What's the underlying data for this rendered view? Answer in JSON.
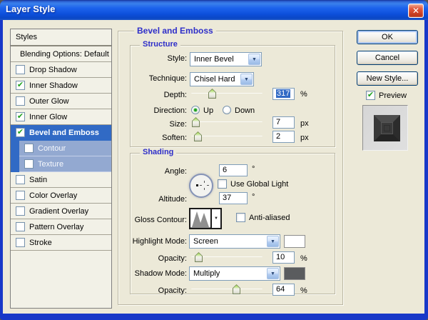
{
  "window": {
    "title": "Layer Style"
  },
  "icons": {
    "close": "✕",
    "combo_arrow": "▼",
    "check": "✔",
    "contour_arrow": "▼"
  },
  "sidebar": {
    "header": "Styles",
    "items": [
      {
        "label": "Blending Options: Default",
        "type": "plain"
      },
      {
        "label": "Drop Shadow",
        "checked": false
      },
      {
        "label": "Inner Shadow",
        "checked": true
      },
      {
        "label": "Outer Glow",
        "checked": false
      },
      {
        "label": "Inner Glow",
        "checked": true
      },
      {
        "label": "Bevel and Emboss",
        "checked": true,
        "selected": true
      },
      {
        "label": "Contour",
        "checked": false,
        "sub": true
      },
      {
        "label": "Texture",
        "checked": false,
        "sub": true
      },
      {
        "label": "Satin",
        "checked": false
      },
      {
        "label": "Color Overlay",
        "checked": false
      },
      {
        "label": "Gradient Overlay",
        "checked": false
      },
      {
        "label": "Pattern Overlay",
        "checked": false
      },
      {
        "label": "Stroke",
        "checked": false
      }
    ]
  },
  "panel": {
    "title": "Bevel and Emboss",
    "structure": {
      "title": "Structure",
      "style_label": "Style:",
      "style_value": "Inner Bevel",
      "technique_label": "Technique:",
      "technique_value": "Chisel Hard",
      "depth_label": "Depth:",
      "depth_value": "317",
      "depth_unit": "%",
      "depth_percent": 29,
      "direction_label": "Direction:",
      "direction_options": [
        "Up",
        "Down"
      ],
      "direction_selected": "Up",
      "size_label": "Size:",
      "size_value": "7",
      "size_unit": "px",
      "size_percent": 6,
      "soften_label": "Soften:",
      "soften_value": "2",
      "soften_unit": "px",
      "soften_percent": 9
    },
    "shading": {
      "title": "Shading",
      "angle_label": "Angle:",
      "angle_value": "6",
      "angle_unit": "°",
      "use_global_light_label": "Use Global Light",
      "use_global_light_checked": false,
      "altitude_label": "Altitude:",
      "altitude_value": "37",
      "altitude_unit": "°",
      "gloss_contour_label": "Gloss Contour:",
      "anti_aliased_label": "Anti-aliased",
      "anti_aliased_checked": false,
      "highlight_mode_label": "Highlight Mode:",
      "highlight_mode_value": "Screen",
      "highlight_color": "#FFFFFF",
      "highlight_opacity_label": "Opacity:",
      "highlight_opacity_value": "10",
      "highlight_opacity_unit": "%",
      "highlight_opacity_percent": 10,
      "shadow_mode_label": "Shadow Mode:",
      "shadow_mode_value": "Multiply",
      "shadow_color": "#5A5C5E",
      "shadow_opacity_label": "Opacity:",
      "shadow_opacity_value": "64",
      "shadow_opacity_unit": "%",
      "shadow_opacity_percent": 63
    }
  },
  "actions": {
    "ok": "OK",
    "cancel": "Cancel",
    "new_style": "New Style...",
    "preview_label": "Preview",
    "preview_checked": true
  },
  "colors": {
    "selection": "#316AC5",
    "subrow": "#93A9D1",
    "group_title": "#2E2EC9",
    "titlebar": "#1D63EC"
  }
}
